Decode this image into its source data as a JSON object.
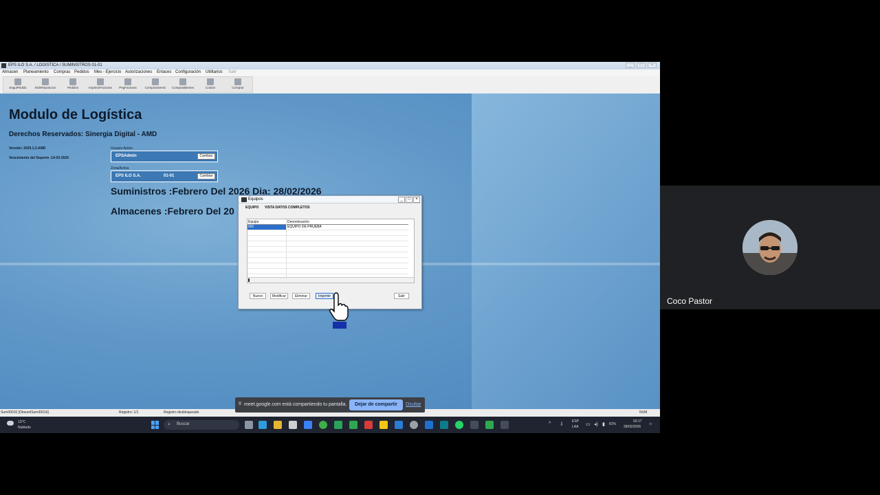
{
  "window": {
    "title": "EPS ILO S.A. / LOGISTICA / SUMINISTROS 01-01"
  },
  "menu": [
    "Almacen",
    "Planeamiento",
    "Compras",
    "Pedidos",
    "Mes - Ejercicio",
    "Autorizaciones",
    "Enlaces",
    "Configuración",
    "Utilitarios",
    "Salir"
  ],
  "toolbar": [
    "SeguiPedido",
    "StckReposicion",
    "Pedidos",
    "ImprimirFacturas",
    "PegFacturas",
    "ComprasServic",
    "ComprasBienes",
    "Cotizar",
    "Comprar"
  ],
  "main": {
    "title": "Modulo de Logística",
    "rights": "Derechos Reservados:  Sinergia Digital - AMD",
    "version": "Versión: 2025.1.3.AMD",
    "support": "Vencimiento del Soporte :14-03-2026",
    "user_label": "Usuario Activo",
    "user_value": "EPSAdmin",
    "user_btn": "Cambiar",
    "zone_label": "Zona/Activa",
    "zone_value": "EPS ILO S.A.",
    "zone_code": "01-01",
    "zone_btn": "Cambiar",
    "suministros": "Suministros :Febrero Del 2026 Dia: 28/02/2026",
    "almacenes": "Almacenes   :Febrero Del 20"
  },
  "dialog": {
    "title": "Equipos",
    "tabs": [
      "EQUIPO",
      "VISTA DATOS COMPLETOS"
    ],
    "columns": [
      "Equipo",
      "Denominación"
    ],
    "rows": [
      {
        "code": "001",
        "name": "EQUIPO DE PRUEBA"
      }
    ],
    "buttons": {
      "new": "Nuevo",
      "edit": "Modificar",
      "delete": "Eliminar",
      "print": "Imprimir",
      "exit": "Salir"
    }
  },
  "status": {
    "db": "Sum30016 [ObsumlSum30016]",
    "record": "Registro: 1/1",
    "lock": "Registro desbloqueado",
    "num": "NUM"
  },
  "taskbar": {
    "weather_temp": "13°C",
    "weather_text": "Nublado",
    "search": "Buscar",
    "lang1": "ESP",
    "lang2": "LAA",
    "battery": "81%",
    "time": "03:17",
    "date": "28/02/2026"
  },
  "meet": {
    "message": "meet.google.com está compartiendo tu pantalla.",
    "stop": "Dejar de compartir",
    "hide": "Ocultar"
  },
  "participant": {
    "name": "Coco Pastor"
  }
}
